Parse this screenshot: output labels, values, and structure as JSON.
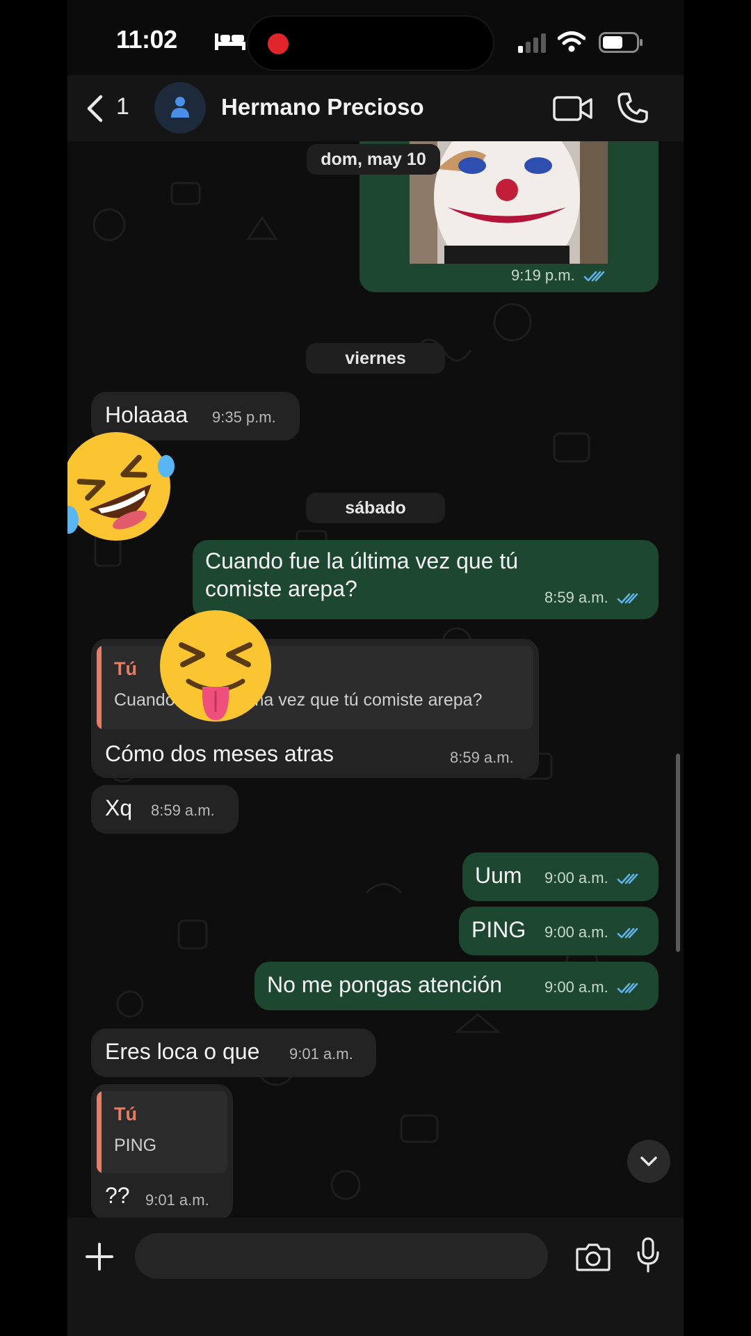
{
  "status_bar": {
    "time": "11:02"
  },
  "header": {
    "back_count": "1",
    "contact_name": "Hermano Precioso"
  },
  "chat": {
    "date_pills": {
      "first": "dom, may 10",
      "second": "viernes",
      "third": "sábado"
    },
    "photo_message": {
      "time": "9:19 p.m."
    },
    "messages": [
      {
        "text": "Holaaaa",
        "time": "9:35 p.m."
      },
      {
        "text": "Cuando fue la última vez que tú comiste arepa?",
        "time": "8:59 a.m."
      },
      {
        "reply_author": "Tú",
        "reply_text": "Cuando fue la última vez que tú comiste arepa?",
        "text": "Cómo dos meses atras",
        "time": "8:59 a.m."
      },
      {
        "text": "Xq",
        "time": "8:59 a.m."
      },
      {
        "text": "Uum",
        "time": "9:00 a.m."
      },
      {
        "text": "PING",
        "time": "9:00 a.m."
      },
      {
        "text": "No me pongas atención",
        "time": "9:00 a.m."
      },
      {
        "text": "Eres loca o que",
        "time": "9:01 a.m."
      },
      {
        "reply_author": "Tú",
        "reply_text": "PING",
        "text": "??",
        "time": "9:01 a.m."
      }
    ]
  },
  "input_bar": {
    "placeholder": ""
  },
  "colors": {
    "outgoing_bubble": "#1d4731",
    "incoming_bubble": "#232323",
    "read_ticks": "#5fb3e8",
    "reply_accent": "#ea7c66",
    "recording_dot": "#e0262c"
  },
  "icons": [
    "bed-icon",
    "record-dot-icon",
    "signal-icon",
    "wifi-icon",
    "battery-icon",
    "back-chevron-icon",
    "avatar-icon",
    "video-call-icon",
    "phone-icon",
    "scroll-down-icon",
    "plus-icon",
    "sticker-icon",
    "camera-icon",
    "microphone-icon",
    "laughing-emoji",
    "tongue-emoji"
  ]
}
